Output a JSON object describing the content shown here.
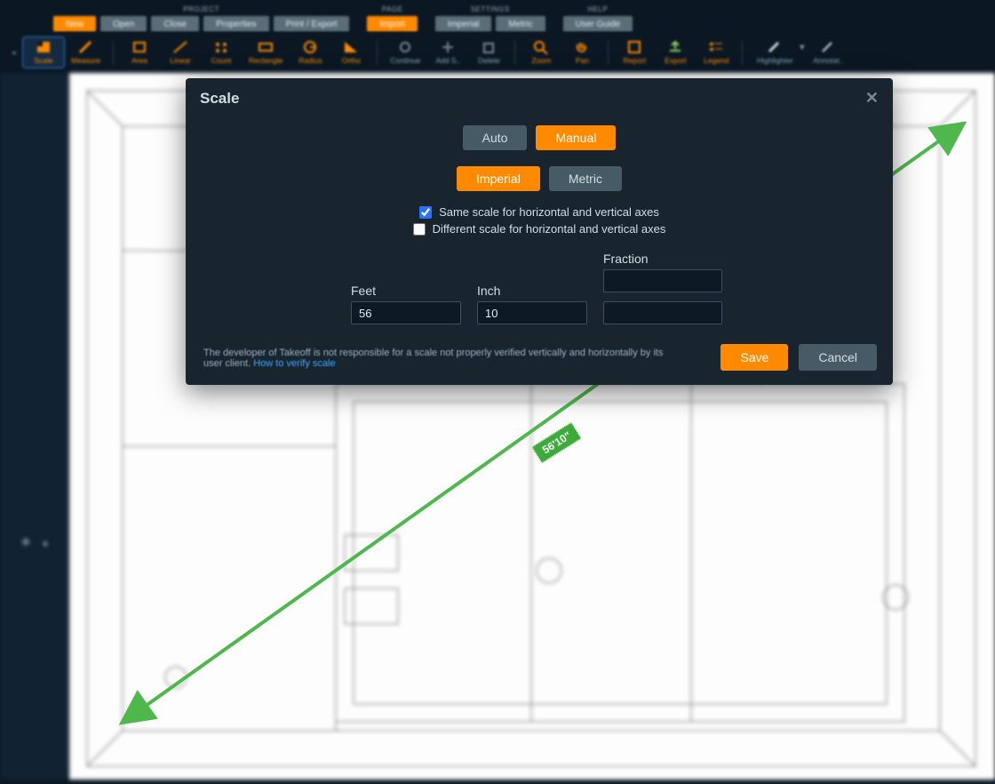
{
  "topbar": {
    "groups": {
      "project": {
        "label": "PROJECT",
        "new": "New",
        "open": "Open",
        "close": "Close",
        "properties": "Properties",
        "print_export": "Print / Export"
      },
      "page": {
        "label": "PAGE",
        "import": "Import"
      },
      "settings": {
        "label": "SETTINGS",
        "imperial": "Imperial",
        "metric": "Metric"
      },
      "help": {
        "label": "HELP",
        "guide": "User Guide"
      }
    }
  },
  "toolbar": {
    "scale": "Scale",
    "measure": "Measure",
    "area": "Area",
    "linear": "Linear",
    "count": "Count",
    "rectangle": "Rectangle",
    "radius": "Radius",
    "ortho": "Ortho",
    "continue": "Continue",
    "add_s": "Add S..",
    "delete": "Delete",
    "zoom": "Zoom",
    "pan": "Pan",
    "report": "Report",
    "export": "Export",
    "legend": "Legend",
    "highlighter": "Highlighter",
    "annotate": "Annotat.."
  },
  "measure": {
    "display": "56'10\""
  },
  "modal": {
    "title": "Scale",
    "mode": {
      "auto": "Auto",
      "manual": "Manual"
    },
    "units": {
      "imperial": "Imperial",
      "metric": "Metric"
    },
    "same_axes_label": "Same scale for horizontal and vertical axes",
    "diff_axes_label": "Different scale for horizontal and vertical axes",
    "same_axes_checked": true,
    "diff_axes_checked": false,
    "feet_label": "Feet",
    "feet_value": "56",
    "inch_label": "Inch",
    "inch_value": "10",
    "fraction_label": "Fraction",
    "fraction_value_1": "",
    "fraction_value_2": "",
    "disclaimer": "The developer of Takeoff is not responsible for a scale not properly verified vertically and horizontally by its user client. ",
    "disclaimer_link": "How to verify scale",
    "save": "Save",
    "cancel": "Cancel"
  }
}
